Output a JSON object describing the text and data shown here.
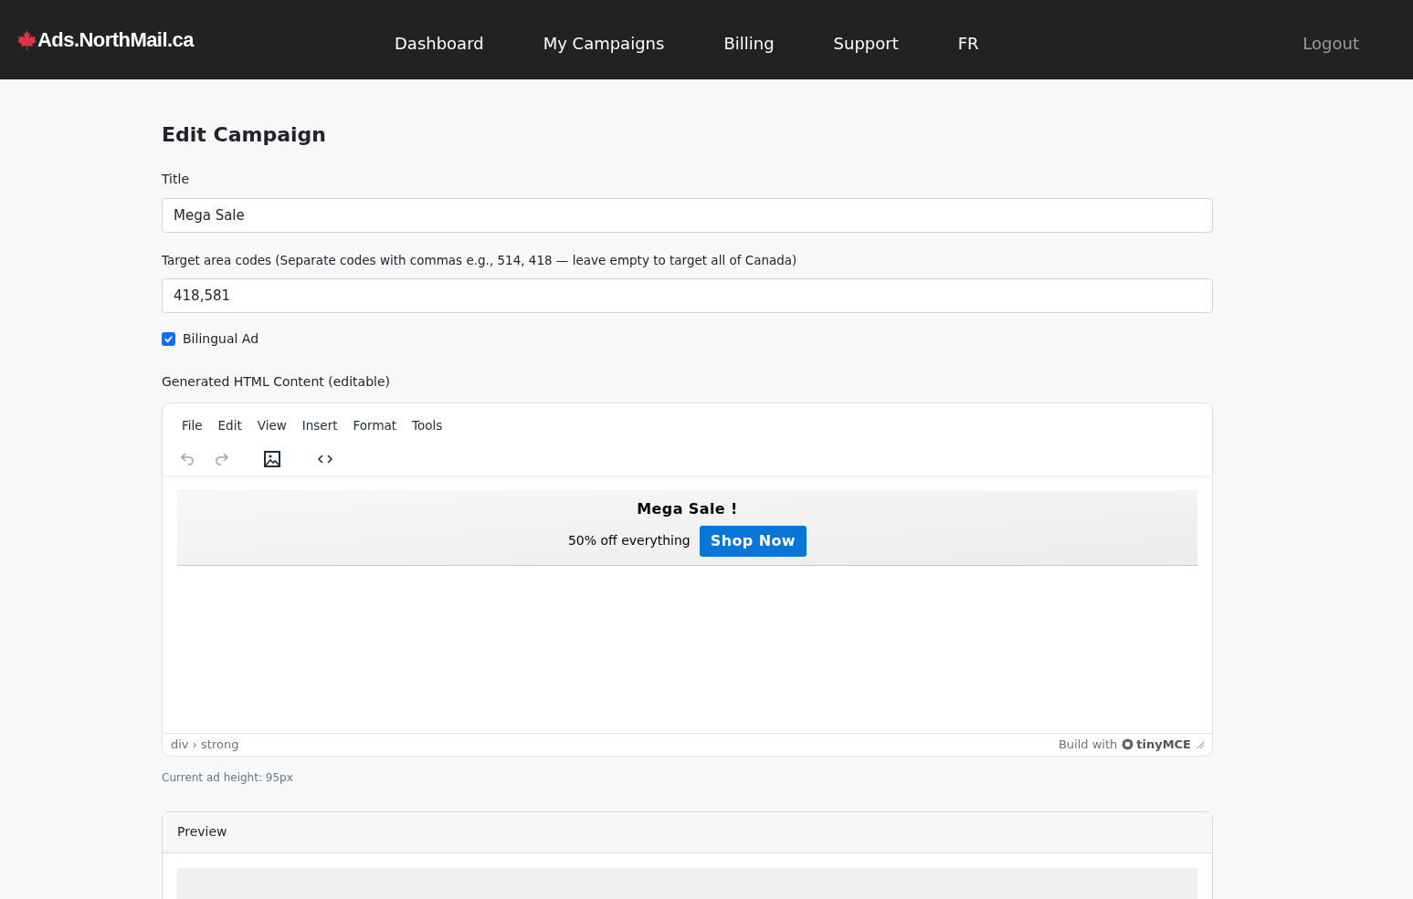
{
  "nav": {
    "brand": "Ads.NorthMail.ca",
    "links": [
      {
        "label": "Dashboard"
      },
      {
        "label": "My Campaigns"
      },
      {
        "label": "Billing"
      },
      {
        "label": "Support"
      },
      {
        "label": "FR"
      }
    ],
    "logout": "Logout"
  },
  "page_title": "Edit Campaign",
  "title_field": {
    "label": "Title",
    "value": "Mega Sale"
  },
  "area_field": {
    "label": "Target area codes (Separate codes with commas e.g., 514, 418 — leave empty to target all of Canada)",
    "value": "418,581"
  },
  "bilingual": {
    "label": "Bilingual Ad",
    "checked": true
  },
  "editor_label": "Generated HTML Content (editable)",
  "editor": {
    "menu": [
      "File",
      "Edit",
      "View",
      "Insert",
      "Format",
      "Tools"
    ],
    "toolbar": [
      {
        "kind": "undo",
        "disabled": true
      },
      {
        "kind": "redo",
        "disabled": true
      },
      {
        "kind": "image",
        "disabled": false
      },
      {
        "kind": "code",
        "disabled": false
      }
    ],
    "ad": {
      "heading": "Mega Sale !",
      "text": "50% off everything",
      "button": "Shop Now"
    },
    "path": "div › strong",
    "branding_prefix": "Build with",
    "branding_logo": "tinyMCE"
  },
  "height_note": "Current ad height: 95px",
  "preview": {
    "title": "Preview"
  }
}
